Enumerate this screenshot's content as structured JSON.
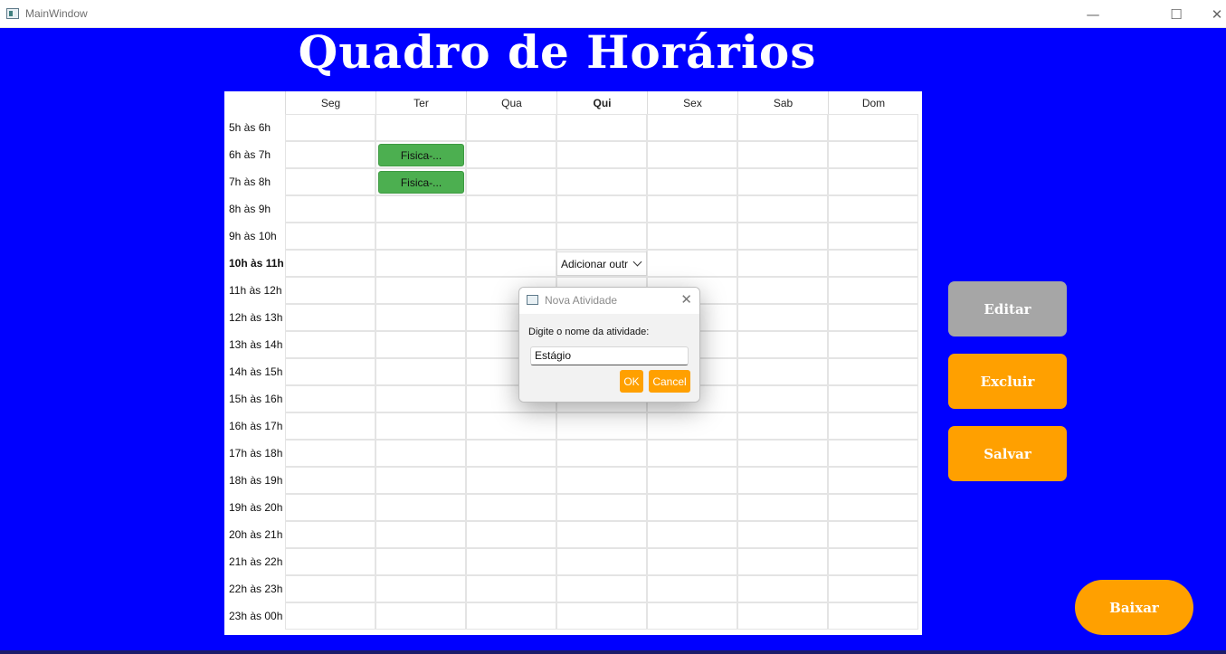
{
  "window": {
    "title": "MainWindow",
    "minimize_glyph": "—",
    "maximize_glyph": "☐",
    "close_glyph": "✕"
  },
  "page": {
    "title": "Quadro de Horários"
  },
  "schedule": {
    "days": [
      "Seg",
      "Ter",
      "Qua",
      "Qui",
      "Sex",
      "Sab",
      "Dom"
    ],
    "highlight_day": "Qui",
    "slots": [
      "5h às 6h",
      "6h às 7h",
      "7h às 8h",
      "8h às 9h",
      "9h às 10h",
      "10h às 11h",
      "11h às 12h",
      "12h às 13h",
      "13h às 14h",
      "14h às 15h",
      "15h às 16h",
      "16h às 17h",
      "17h às 18h",
      "18h às 19h",
      "19h às 20h",
      "20h às 21h",
      "21h às 22h",
      "22h às 23h",
      "23h às 00h"
    ],
    "highlight_slot": "10h às 11h",
    "events": [
      {
        "day": "Ter",
        "slot": "6h às 7h",
        "label": "Fisica-..."
      },
      {
        "day": "Ter",
        "slot": "7h às 8h",
        "label": "Fisica-..."
      }
    ],
    "combo": {
      "day": "Qui",
      "slot": "10h às 11h",
      "value": "Adicionar outr"
    }
  },
  "dialog": {
    "title": "Nova Atividade",
    "close_glyph": "✕",
    "prompt": "Digite o nome da atividade:",
    "input_value": "Estágio",
    "ok_label": "OK",
    "cancel_label": "Cancel"
  },
  "actions": {
    "edit_label": "Editar",
    "delete_label": "Excluir",
    "save_label": "Salvar",
    "download_label": "Baixar"
  },
  "colors": {
    "background": "#0000ff",
    "event": "#4caf50",
    "accent": "#ffa000",
    "disabled": "#a6a6a6"
  }
}
